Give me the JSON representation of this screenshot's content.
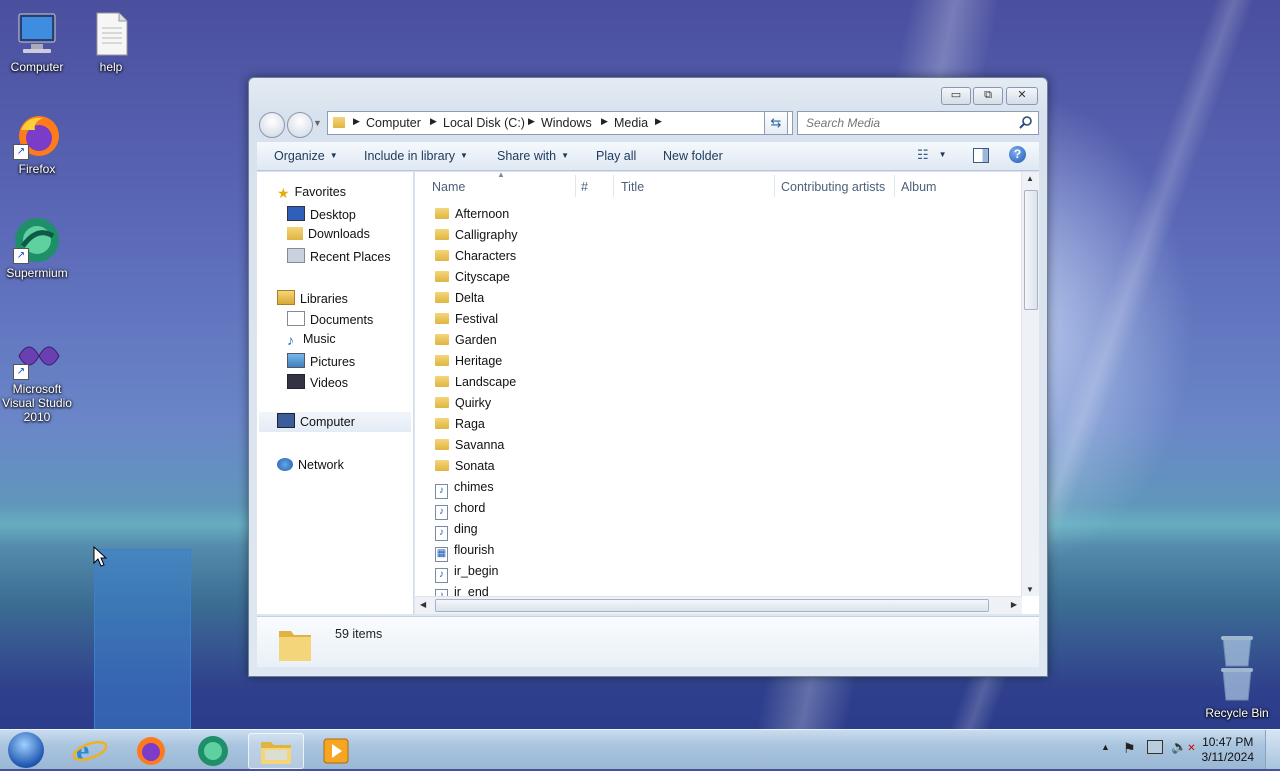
{
  "desktop": {
    "icons": [
      {
        "label": "Computer"
      },
      {
        "label": "help"
      },
      {
        "label": "Firefox"
      },
      {
        "label": "Supermium"
      },
      {
        "label": "Microsoft Visual Studio 2010"
      },
      {
        "label": "Recycle Bin"
      }
    ]
  },
  "window": {
    "controls": {
      "minimize": "▭",
      "maximize": "⧉",
      "close": "✕"
    },
    "breadcrumb": [
      "Computer",
      "Local Disk (C:)",
      "Windows",
      "Media"
    ],
    "search_placeholder": "Search Media",
    "toolbar": {
      "organize": "Organize",
      "include": "Include in library",
      "share": "Share with",
      "play": "Play all",
      "new_folder": "New folder"
    },
    "nav": {
      "favorites": "Favorites",
      "desktop": "Desktop",
      "downloads": "Downloads",
      "recent": "Recent Places",
      "libraries": "Libraries",
      "documents": "Documents",
      "music": "Music",
      "pictures": "Pictures",
      "videos": "Videos",
      "computer": "Computer",
      "network": "Network"
    },
    "columns": {
      "name": "Name",
      "num": "#",
      "title": "Title",
      "artists": "Contributing artists",
      "album": "Album"
    },
    "files": [
      "Afternoon",
      "Calligraphy",
      "Characters",
      "Cityscape",
      "Delta",
      "Festival",
      "Garden",
      "Heritage",
      "Landscape",
      "Quirky",
      "Raga",
      "Savanna",
      "Sonata",
      "chimes",
      "chord",
      "ding",
      "flourish",
      "ir_begin",
      "ir_end"
    ],
    "item_count": "59 items"
  },
  "taskbar": {
    "time": "10:47 PM",
    "date": "3/11/2024"
  }
}
